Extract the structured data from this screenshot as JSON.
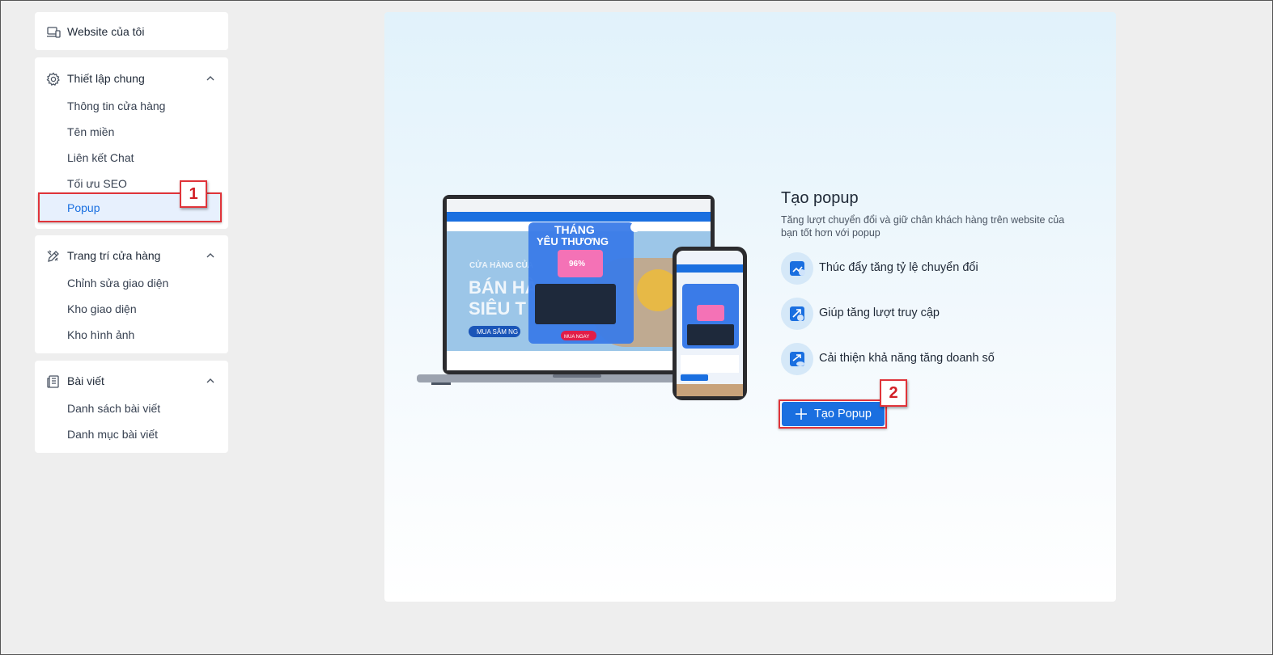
{
  "sidebar": {
    "my_website": "Website của tôi",
    "general": {
      "title": "Thiết lập chung",
      "items": [
        "Thông tin cửa hàng",
        "Tên miền",
        "Liên kết Chat",
        "Tối ưu SEO",
        "Popup"
      ]
    },
    "decor": {
      "title": "Trang trí cửa hàng",
      "items": [
        "Chỉnh sửa giao diện",
        "Kho giao diện",
        "Kho hình ảnh"
      ]
    },
    "blog": {
      "title": "Bài viết",
      "items": [
        "Danh sách bài viết",
        "Danh mục bài viết"
      ]
    }
  },
  "main": {
    "title": "Tạo popup",
    "description": "Tăng lượt chuyển đổi và giữ chân khách hàng trên website của bạn tốt hơn với popup",
    "features": [
      "Thúc đẩy tăng tỷ lệ chuyển đổi",
      "Giúp tăng lượt truy cập",
      "Cải thiện khả năng tăng doanh số"
    ],
    "button_label": "Tạo Popup",
    "illustration": {
      "headline_1": "THÁNG",
      "headline_2": "YÊU THƯƠNG",
      "promo": "96%",
      "banner_1": "CỬA HÀNG CỦA",
      "banner_2": "BÁN HÀ",
      "banner_3": "SIÊU T",
      "cta_1": "MUA SẮM NG",
      "cta_2": "MUA NGAY"
    }
  },
  "annotations": {
    "step_1": "1",
    "step_2": "2"
  },
  "colors": {
    "accent": "#1a6fe0",
    "annotation": "#e0343a",
    "active_bg": "#e7f0fd"
  }
}
